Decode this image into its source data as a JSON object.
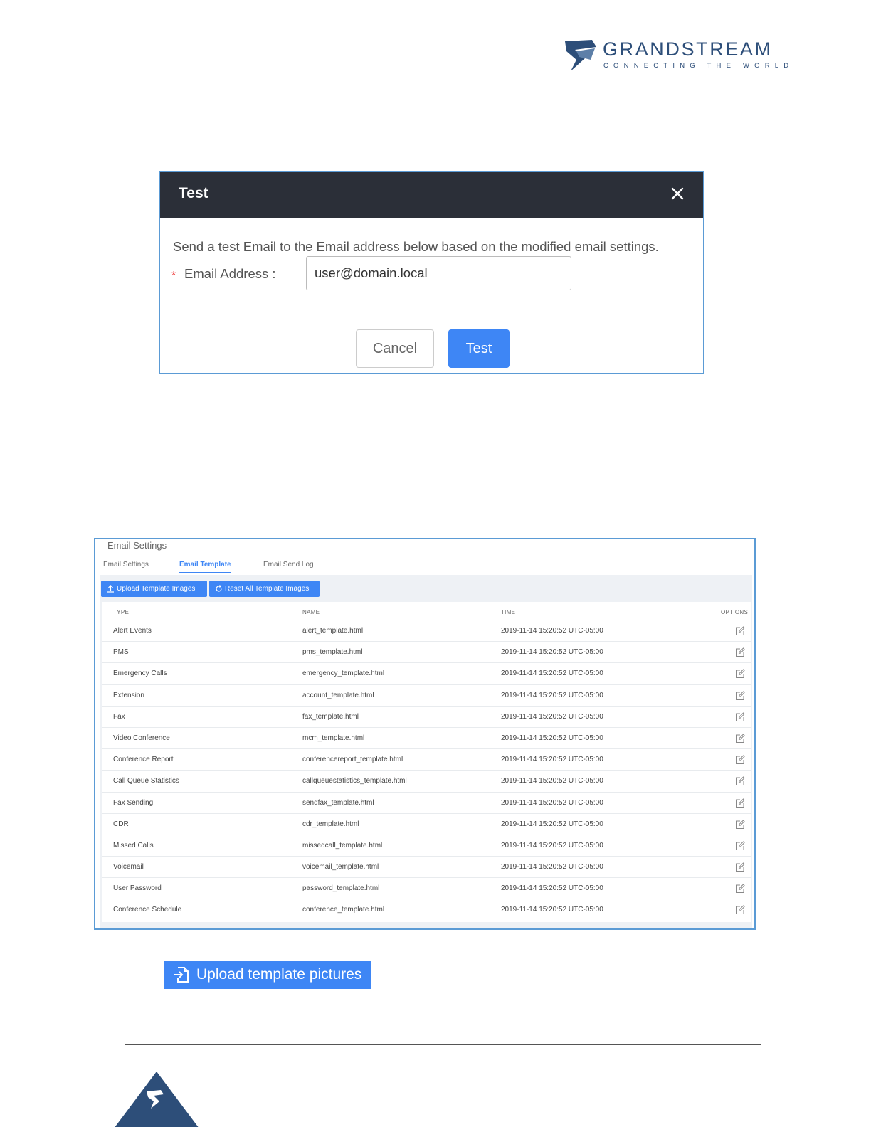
{
  "logo": {
    "brand": "GRANDSTREAM",
    "tagline": "CONNECTING THE WORLD",
    "icon": "grandstream-logo-icon",
    "color": "#2d4e79"
  },
  "test_dialog": {
    "title": "Test",
    "description": "Send a test Email to the Email address below based on the modified email settings.",
    "required_marker": "*",
    "email_label": "Email Address :",
    "email_value": "user@domain.local",
    "cancel_label": "Cancel",
    "test_label": "Test",
    "header_color": "#2b2f38",
    "accent_color": "#3e86f5"
  },
  "email_panel": {
    "title": "Email Settings",
    "tabs": [
      {
        "label": "Email Settings",
        "active": false
      },
      {
        "label": "Email Template",
        "active": true
      },
      {
        "label": "Email Send Log",
        "active": false
      }
    ],
    "toolbar": {
      "upload_label": "Upload Template Images",
      "reset_label": "Reset All Template Images"
    },
    "columns": [
      "TYPE",
      "NAME",
      "TIME",
      "OPTIONS"
    ],
    "rows": [
      {
        "type": "Alert Events",
        "name": "alert_template.html",
        "time": "2019-11-14 15:20:52 UTC-05:00"
      },
      {
        "type": "PMS",
        "name": "pms_template.html",
        "time": "2019-11-14 15:20:52 UTC-05:00"
      },
      {
        "type": "Emergency Calls",
        "name": "emergency_template.html",
        "time": "2019-11-14 15:20:52 UTC-05:00"
      },
      {
        "type": "Extension",
        "name": "account_template.html",
        "time": "2019-11-14 15:20:52 UTC-05:00"
      },
      {
        "type": "Fax",
        "name": "fax_template.html",
        "time": "2019-11-14 15:20:52 UTC-05:00"
      },
      {
        "type": "Video Conference",
        "name": "mcm_template.html",
        "time": "2019-11-14 15:20:52 UTC-05:00"
      },
      {
        "type": "Conference Report",
        "name": "conferencereport_template.html",
        "time": "2019-11-14 15:20:52 UTC-05:00"
      },
      {
        "type": "Call Queue Statistics",
        "name": "callqueuestatistics_template.html",
        "time": "2019-11-14 15:20:52 UTC-05:00"
      },
      {
        "type": "Fax Sending",
        "name": "sendfax_template.html",
        "time": "2019-11-14 15:20:52 UTC-05:00"
      },
      {
        "type": "CDR",
        "name": "cdr_template.html",
        "time": "2019-11-14 15:20:52 UTC-05:00"
      },
      {
        "type": "Missed Calls",
        "name": "missedcall_template.html",
        "time": "2019-11-14 15:20:52 UTC-05:00"
      },
      {
        "type": "Voicemail",
        "name": "voicemail_template.html",
        "time": "2019-11-14 15:20:52 UTC-05:00"
      },
      {
        "type": "User Password",
        "name": "password_template.html",
        "time": "2019-11-14 15:20:52 UTC-05:00"
      },
      {
        "type": "Conference Schedule",
        "name": "conference_template.html",
        "time": "2019-11-14 15:20:52 UTC-05:00"
      }
    ]
  },
  "upload_pictures_button": {
    "label": "Upload template pictures",
    "icon": "file-import-icon"
  }
}
